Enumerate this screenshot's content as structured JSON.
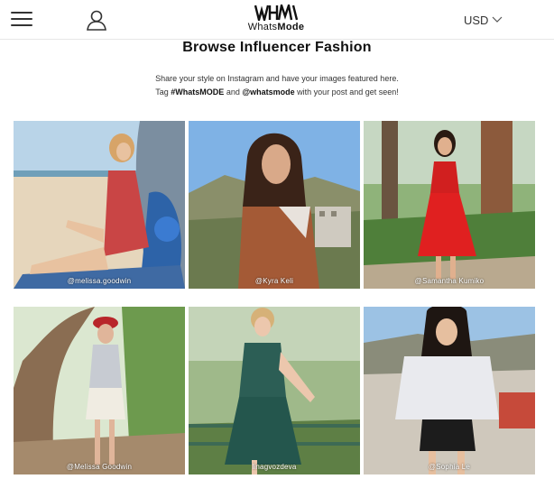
{
  "header": {
    "brand_prefix": "Whats",
    "brand_suffix": "Mode",
    "currency": "USD"
  },
  "main": {
    "title": "Browse Influencer Fashion",
    "intro_line1": "Share your style on Instagram and have your images featured here.",
    "intro_tag": "Tag",
    "hashtag": "#WhatsMODE",
    "and": "and",
    "mention": "@whatsmode",
    "intro_tail": "with your post and get seen!"
  },
  "gallery": [
    {
      "handle": "@melissa.goodwin"
    },
    {
      "handle": "@Kyra Keli"
    },
    {
      "handle": "@Samantha Kumiko"
    },
    {
      "handle": "@Melissa Goodwin"
    },
    {
      "handle": "linagvozdeva"
    },
    {
      "handle": "@Sophia Le"
    }
  ],
  "colors": {
    "accent": "#111111",
    "header_border": "#e6e6e6"
  }
}
